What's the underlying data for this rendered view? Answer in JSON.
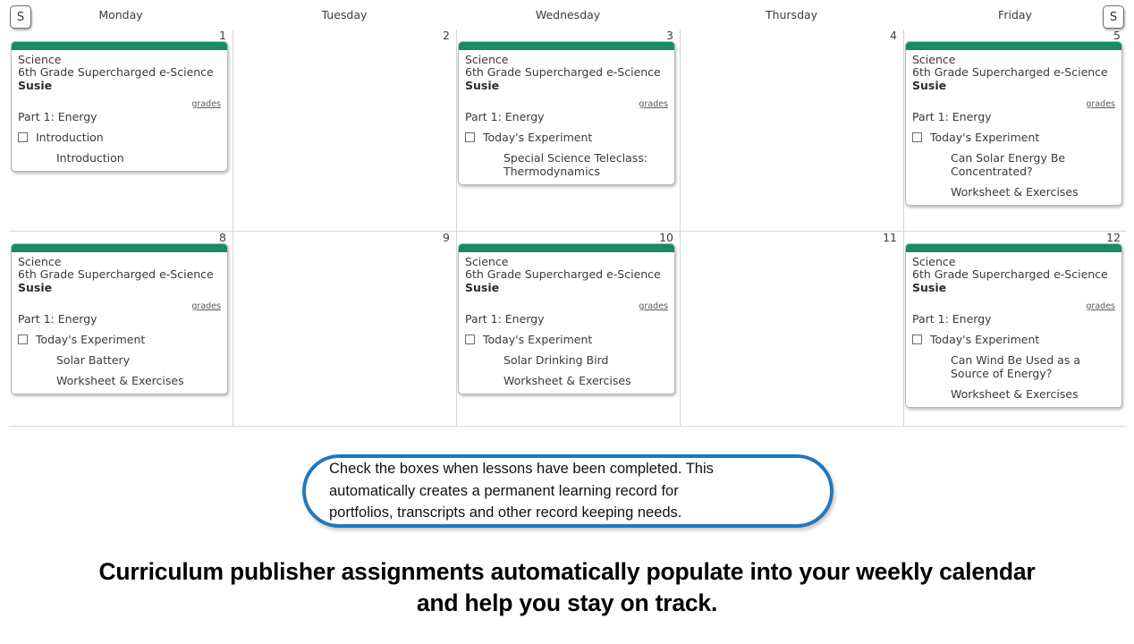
{
  "colors": {
    "accent_green": "#1a8a62",
    "callout_border_blue": "#1f79bd",
    "grid_line": "#d6d6d6",
    "card_border": "#b8b8b8"
  },
  "header": {
    "scroll_left_label": "S",
    "scroll_right_label": "S",
    "weekdays": [
      "Monday",
      "Tuesday",
      "Wednesday",
      "Thursday",
      "Friday"
    ]
  },
  "calendar": {
    "rows": [
      {
        "days": [
          {
            "number": "1",
            "card": {
              "course_name": "Science",
              "course_title": "6th Grade Supercharged e-Science",
              "student": "Susie",
              "grades_link": "grades",
              "part": "Part 1: Energy",
              "task": "Introduction",
              "sub_items": [
                "Introduction"
              ]
            }
          },
          {
            "number": "2",
            "card": null
          },
          {
            "number": "3",
            "card": {
              "course_name": "Science",
              "course_title": "6th Grade Supercharged e-Science",
              "student": "Susie",
              "grades_link": "grades",
              "part": "Part 1: Energy",
              "task": "Today's Experiment",
              "sub_items": [
                "Special Science Teleclass: Thermodynamics"
              ]
            }
          },
          {
            "number": "4",
            "card": null
          },
          {
            "number": "5",
            "card": {
              "course_name": "Science",
              "course_title": "6th Grade Supercharged e-Science",
              "student": "Susie",
              "grades_link": "grades",
              "part": "Part 1: Energy",
              "task": "Today's Experiment",
              "sub_items": [
                "Can Solar Energy Be Concentrated?",
                "Worksheet & Exercises"
              ]
            }
          }
        ]
      },
      {
        "days": [
          {
            "number": "8",
            "card": {
              "course_name": "Science",
              "course_title": "6th Grade Supercharged e-Science",
              "student": "Susie",
              "grades_link": "grades",
              "part": "Part 1: Energy",
              "task": "Today's Experiment",
              "sub_items": [
                "Solar Battery",
                "Worksheet & Exercises"
              ]
            }
          },
          {
            "number": "9",
            "card": null
          },
          {
            "number": "10",
            "card": {
              "course_name": "Science",
              "course_title": "6th Grade Supercharged e-Science",
              "student": "Susie",
              "grades_link": "grades",
              "part": "Part 1: Energy",
              "task": "Today's Experiment",
              "sub_items": [
                "Solar Drinking Bird",
                "Worksheet & Exercises"
              ]
            }
          },
          {
            "number": "11",
            "card": null
          },
          {
            "number": "12",
            "card": {
              "course_name": "Science",
              "course_title": "6th Grade Supercharged e-Science",
              "student": "Susie",
              "grades_link": "grades",
              "part": "Part 1: Energy",
              "task": "Today's Experiment",
              "sub_items": [
                "Can Wind Be Used as a Source of Energy?",
                "Worksheet & Exercises"
              ]
            }
          }
        ]
      }
    ]
  },
  "callout": {
    "text": "Check the boxes when lessons have been completed. This\nautomatically creates a permanent learning record for\nportfolios, transcripts and other record keeping needs."
  },
  "bottom_heading": {
    "text": "Curriculum publisher assignments automatically populate into your weekly calendar\nand help you stay on track."
  }
}
